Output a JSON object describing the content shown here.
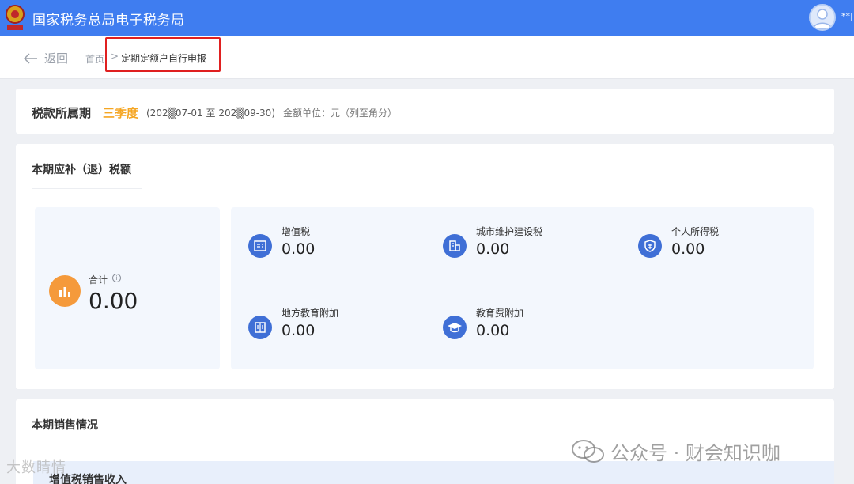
{
  "header": {
    "app_title": "国家税务总局电子税务局",
    "user_name": "**|"
  },
  "nav": {
    "back_label": "返回",
    "breadcrumb": [
      "首页",
      "定期定额户自行申报"
    ],
    "separator": ">"
  },
  "period": {
    "label": "税款所属期",
    "quarter": "三季度",
    "range": "(202▒07-01 至 202▒09-30)",
    "unit": "金额单位：元（列至角分）"
  },
  "tax_section": {
    "title": "本期应补（退）税额",
    "total": {
      "label": "合计",
      "value": "0.00",
      "icon": "bar-chart-icon"
    },
    "items": [
      {
        "name": "增值税",
        "value": "0.00",
        "icon": "invoice-icon"
      },
      {
        "name": "城市维护建设税",
        "value": "0.00",
        "icon": "building-icon"
      },
      {
        "name": "个人所得税",
        "value": "0.00",
        "icon": "shield-tax-icon"
      },
      {
        "name": "地方教育附加",
        "value": "0.00",
        "icon": "book-icon"
      },
      {
        "name": "教育费附加",
        "value": "0.00",
        "icon": "graduation-cap-icon"
      }
    ]
  },
  "sales_section": {
    "title": "本期销售情况",
    "subtitle": "增值税销售收入"
  },
  "watermarks": {
    "left": "大数睛情",
    "right": "公众号 · 财会知识咖"
  },
  "colors": {
    "primary": "#3f7df0",
    "accent": "#f5a623",
    "highlight": "#e02020",
    "total_icon": "#f59a3b",
    "item_icon": "#3f6fd6"
  }
}
